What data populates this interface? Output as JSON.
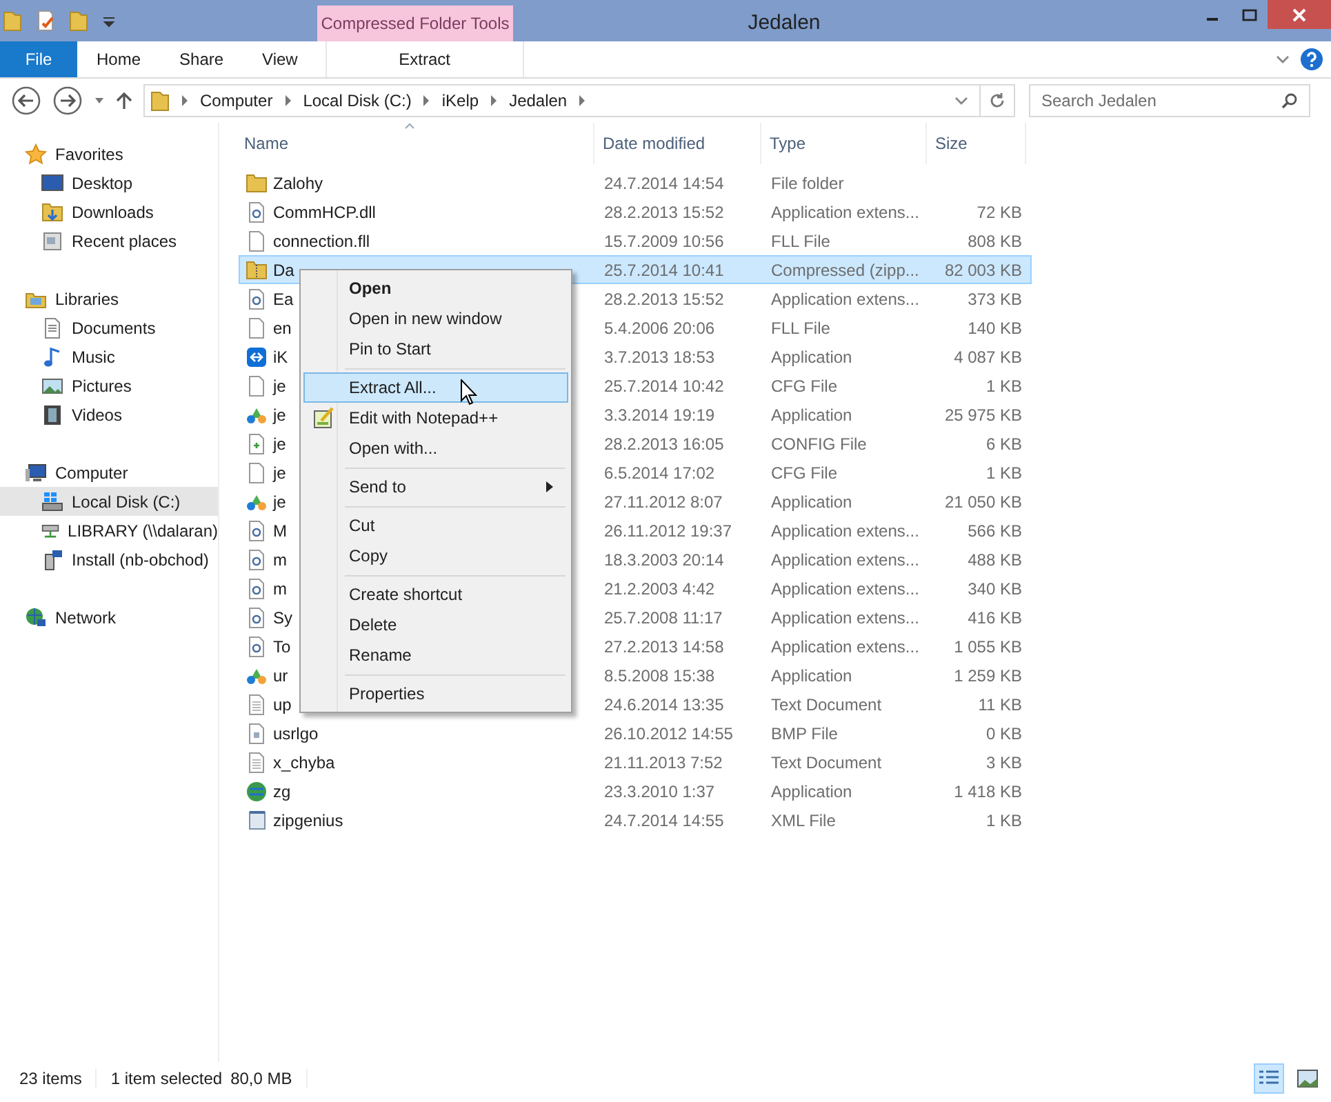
{
  "window": {
    "title": "Jedalen",
    "contextual_tab_group": "Compressed Folder Tools"
  },
  "ribbon_tabs": [
    {
      "label": "File",
      "kind": "file",
      "selected": false
    },
    {
      "label": "Home",
      "kind": "tab",
      "selected": false
    },
    {
      "label": "Share",
      "kind": "tab",
      "selected": false
    },
    {
      "label": "View",
      "kind": "tab",
      "selected": false
    },
    {
      "label": "Extract",
      "kind": "contextual",
      "selected": false
    }
  ],
  "address_bar": {
    "breadcrumbs": [
      "Computer",
      "Local Disk (C:)",
      "iKelp",
      "Jedalen"
    ]
  },
  "search": {
    "placeholder": "Search Jedalen"
  },
  "sidebar": {
    "groups": [
      {
        "label": "Favorites",
        "kind": "favorites",
        "children": [
          {
            "label": "Desktop",
            "kind": "desktop",
            "selected": false
          },
          {
            "label": "Downloads",
            "kind": "downloads",
            "selected": false
          },
          {
            "label": "Recent places",
            "kind": "recent",
            "selected": false
          }
        ]
      },
      {
        "label": "Libraries",
        "kind": "libraries",
        "children": [
          {
            "label": "Documents",
            "kind": "documents",
            "selected": false
          },
          {
            "label": "Music",
            "kind": "music",
            "selected": false
          },
          {
            "label": "Pictures",
            "kind": "pictures",
            "selected": false
          },
          {
            "label": "Videos",
            "kind": "videos",
            "selected": false
          }
        ]
      },
      {
        "label": "Computer",
        "kind": "computer",
        "children": [
          {
            "label": "Local Disk (C:)",
            "kind": "disk",
            "selected": true
          },
          {
            "label": "LIBRARY (\\\\dalaran)",
            "kind": "netdrive",
            "selected": false
          },
          {
            "label": "Install (nb-obchod)",
            "kind": "install",
            "selected": false
          }
        ]
      },
      {
        "label": "Network",
        "kind": "network"
      }
    ]
  },
  "table": {
    "columns": [
      "Name",
      "Date modified",
      "Type",
      "Size"
    ],
    "rows": [
      {
        "name": "Zalohy",
        "kind": "folder",
        "date": "24.7.2014 14:54",
        "type": "File folder",
        "selected": false
      },
      {
        "name": "CommHCP.dll",
        "kind": "dll",
        "date": "28.2.2013 15:52",
        "type": "Application extens...",
        "size": "72 KB",
        "selected": false
      },
      {
        "name": "connection.fll",
        "kind": "file",
        "date": "15.7.2009 10:56",
        "type": "FLL File",
        "size": "808 KB",
        "selected": false
      },
      {
        "name": "Da",
        "kind": "zip",
        "date": "25.7.2014 10:41",
        "type": "Compressed (zipp...",
        "size": "82 003 KB",
        "selected": true
      },
      {
        "name": "Ea",
        "kind": "dll",
        "date": "28.2.2013 15:52",
        "type": "Application extens...",
        "size": "373 KB",
        "selected": false
      },
      {
        "name": "en",
        "kind": "file",
        "date": "5.4.2006 20:06",
        "type": "FLL File",
        "size": "140 KB",
        "selected": false
      },
      {
        "name": "iK",
        "kind": "teamviewer",
        "date": "3.7.2013 18:53",
        "type": "Application",
        "size": "4 087 KB",
        "selected": false
      },
      {
        "name": "je",
        "kind": "file",
        "date": "25.7.2014 10:42",
        "type": "CFG File",
        "size": "1 KB",
        "selected": false
      },
      {
        "name": "je",
        "kind": "app",
        "date": "3.3.2014 19:19",
        "type": "Application",
        "size": "25 975 KB",
        "selected": false
      },
      {
        "name": "je",
        "kind": "config",
        "date": "28.2.2013 16:05",
        "type": "CONFIG File",
        "size": "6 KB",
        "selected": false
      },
      {
        "name": "je",
        "kind": "file",
        "date": "6.5.2014 17:02",
        "type": "CFG File",
        "size": "1 KB",
        "selected": false
      },
      {
        "name": "je",
        "kind": "app",
        "date": "27.11.2012 8:07",
        "type": "Application",
        "size": "21 050 KB",
        "selected": false
      },
      {
        "name": "M",
        "kind": "dll",
        "date": "26.11.2012 19:37",
        "type": "Application extens...",
        "size": "566 KB",
        "selected": false
      },
      {
        "name": "m",
        "kind": "dll",
        "date": "18.3.2003 20:14",
        "type": "Application extens...",
        "size": "488 KB",
        "selected": false
      },
      {
        "name": "m",
        "kind": "dll",
        "date": "21.2.2003 4:42",
        "type": "Application extens...",
        "size": "340 KB",
        "selected": false
      },
      {
        "name": "Sy",
        "kind": "dll",
        "date": "25.7.2008 11:17",
        "type": "Application extens...",
        "size": "416 KB",
        "selected": false
      },
      {
        "name": "To",
        "kind": "dll",
        "date": "27.2.2013 14:58",
        "type": "Application extens...",
        "size": "1 055 KB",
        "selected": false
      },
      {
        "name": "ur",
        "kind": "app",
        "date": "8.5.2008 15:38",
        "type": "Application",
        "size": "1 259 KB",
        "selected": false
      },
      {
        "name": "up",
        "kind": "text",
        "date": "24.6.2014 13:35",
        "type": "Text Document",
        "size": "11 KB",
        "selected": false
      },
      {
        "name": "usrlgo",
        "kind": "bmp",
        "date": "26.10.2012 14:55",
        "type": "BMP File",
        "size": "0 KB",
        "selected": false
      },
      {
        "name": "x_chyba",
        "kind": "text",
        "date": "21.11.2013 7:52",
        "type": "Text Document",
        "size": "3 KB",
        "selected": false
      },
      {
        "name": "zg",
        "kind": "globe",
        "date": "23.3.2010 1:37",
        "type": "Application",
        "size": "1 418 KB",
        "selected": false
      },
      {
        "name": "zipgenius",
        "kind": "xml",
        "date": "24.7.2014 14:55",
        "type": "XML File",
        "size": "1 KB",
        "selected": false
      }
    ]
  },
  "context_menu": {
    "items": [
      {
        "kind": "item",
        "label": "Open",
        "default": true,
        "selected": false
      },
      {
        "kind": "item",
        "label": "Open in new window",
        "selected": false
      },
      {
        "kind": "item",
        "label": "Pin to Start",
        "selected": false
      },
      {
        "kind": "separator"
      },
      {
        "kind": "item",
        "label": "Extract All...",
        "selected": true
      },
      {
        "kind": "icon_item",
        "label": "Edit with Notepad++",
        "selected": false
      },
      {
        "kind": "item",
        "label": "Open with...",
        "selected": false
      },
      {
        "kind": "separator"
      },
      {
        "kind": "item",
        "label": "Send to",
        "submenu": true,
        "selected": false
      },
      {
        "kind": "separator"
      },
      {
        "kind": "item",
        "label": "Cut",
        "selected": false
      },
      {
        "kind": "item",
        "label": "Copy",
        "selected": false
      },
      {
        "kind": "separator"
      },
      {
        "kind": "item",
        "label": "Create shortcut",
        "selected": false
      },
      {
        "kind": "item",
        "label": "Delete",
        "selected": false
      },
      {
        "kind": "item",
        "label": "Rename",
        "selected": false
      },
      {
        "kind": "separator"
      },
      {
        "kind": "item",
        "label": "Properties",
        "selected": false
      }
    ]
  },
  "status_bar": {
    "item_count": "23 items",
    "selection": "1 item selected",
    "selection_size": "80,0 MB",
    "views": [
      {
        "kind": "details",
        "selected": true
      },
      {
        "kind": "thumbnails",
        "selected": false
      }
    ]
  }
}
